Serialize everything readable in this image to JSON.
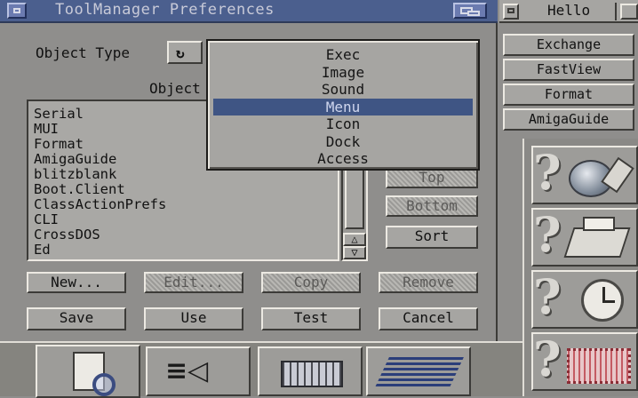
{
  "window": {
    "title": "ToolManager Preferences"
  },
  "hello_window": {
    "title": "Hello"
  },
  "object_type": {
    "label": "Object Type",
    "objects_label": "Object"
  },
  "popup_menu": {
    "items": [
      "Exec",
      "Image",
      "Sound",
      "Menu",
      "Icon",
      "Dock",
      "Access"
    ],
    "selected": "Menu"
  },
  "object_list": [
    "Serial",
    "MUI",
    "Format",
    "AmigaGuide",
    "blitzblank",
    "Boot.Client",
    "ClassActionPrefs",
    "CLI",
    "CrossDOS",
    "Ed"
  ],
  "side_buttons": {
    "top": "Top",
    "bottom": "Bottom",
    "sort": "Sort"
  },
  "action_buttons": {
    "new": "New...",
    "edit": "Edit...",
    "copy": "Copy",
    "remove": "Remove"
  },
  "bottom_buttons": {
    "save": "Save",
    "use": "Use",
    "test": "Test",
    "cancel": "Cancel"
  },
  "hello_buttons": [
    "Exchange",
    "FastView",
    "Format",
    "AmigaGuide"
  ],
  "colors": {
    "title_bar": "#4b5f8e",
    "selection": "#3f5584",
    "panel": "#a6a5a2"
  },
  "icons": [
    "document-magnifier-icon",
    "eye-icon",
    "keyboard-icon",
    "speed-logo-icon",
    "globe-icon",
    "printer-icon",
    "clock-icon",
    "stamp-icon"
  ]
}
